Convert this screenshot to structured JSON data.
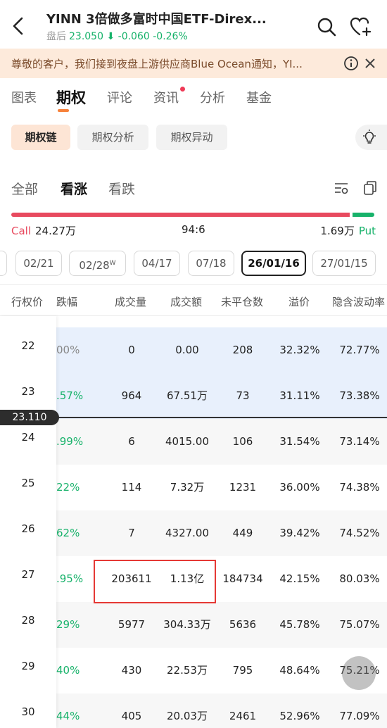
{
  "header": {
    "title": "YINN  3倍做多富时中国ETF-Direx...",
    "session_label": "盘后",
    "price": "23.050",
    "change": "-0.060",
    "change_pct": "-0.26%"
  },
  "notice": {
    "text": "尊敬的客户，我们接到夜盘上游供应商Blue Ocean通知，YI..."
  },
  "main_tabs": [
    "图表",
    "期权",
    "评论",
    "资讯",
    "分析",
    "基金"
  ],
  "active_main_tab": "期权",
  "sub_tabs": [
    "期权链",
    "期权分析",
    "期权异动"
  ],
  "filter_tabs": [
    "全部",
    "看涨",
    "看跌"
  ],
  "ratio": {
    "call_label": "Call",
    "call_value": "24.27万",
    "ratio": "94:6",
    "put_value": "1.69万",
    "put_label": "Put",
    "call_fraction": 0.94
  },
  "dates": [
    "02/21",
    "02/28",
    "04/17",
    "07/18",
    "26/01/16",
    "27/01/15"
  ],
  "date_weekly_mark": "W",
  "selected_date": "26/01/16",
  "table": {
    "headers": [
      "行权价",
      "跌幅",
      "成交量",
      "成交额",
      "未平仓数",
      "溢价",
      "隐含波动率"
    ],
    "rows": [
      {
        "strike": "22",
        "chg": "00%",
        "volume": "0",
        "turnover": "0.00",
        "oi": "208",
        "premium": "32.32%",
        "iv": "72.77%"
      },
      {
        "strike": "23",
        "chg": ".57%",
        "volume": "964",
        "turnover": "67.51万",
        "oi": "73",
        "premium": "31.11%",
        "iv": "73.38%"
      },
      {
        "strike": "24",
        "chg": ".99%",
        "volume": "6",
        "turnover": "4015.00",
        "oi": "106",
        "premium": "31.54%",
        "iv": "73.14%"
      },
      {
        "strike": "25",
        "chg": "22%",
        "volume": "114",
        "turnover": "7.32万",
        "oi": "1231",
        "premium": "36.00%",
        "iv": "74.38%"
      },
      {
        "strike": "26",
        "chg": "62%",
        "volume": "7",
        "turnover": "4327.00",
        "oi": "449",
        "premium": "39.42%",
        "iv": "74.52%"
      },
      {
        "strike": "27",
        "chg": ".95%",
        "volume": "203611",
        "turnover": "1.13亿",
        "oi": "184734",
        "premium": "42.15%",
        "iv": "80.03%"
      },
      {
        "strike": "28",
        "chg": "29%",
        "volume": "5977",
        "turnover": "304.33万",
        "oi": "5636",
        "premium": "45.78%",
        "iv": "75.07%"
      },
      {
        "strike": "29",
        "chg": "40%",
        "volume": "430",
        "turnover": "22.53万",
        "oi": "795",
        "premium": "48.64%",
        "iv": "75.21%"
      },
      {
        "strike": "30",
        "chg": "44%",
        "volume": "405",
        "turnover": "20.03万",
        "oi": "2461",
        "premium": "52.96%",
        "iv": "77.09%"
      }
    ]
  },
  "current_price_tag": "23.110",
  "colors": {
    "up_green": "#17b26a",
    "call_red": "#e84a5f",
    "accent_orange": "#f7823b",
    "itm_blue": "#e8f0fc",
    "highlight_red": "#e53935"
  }
}
